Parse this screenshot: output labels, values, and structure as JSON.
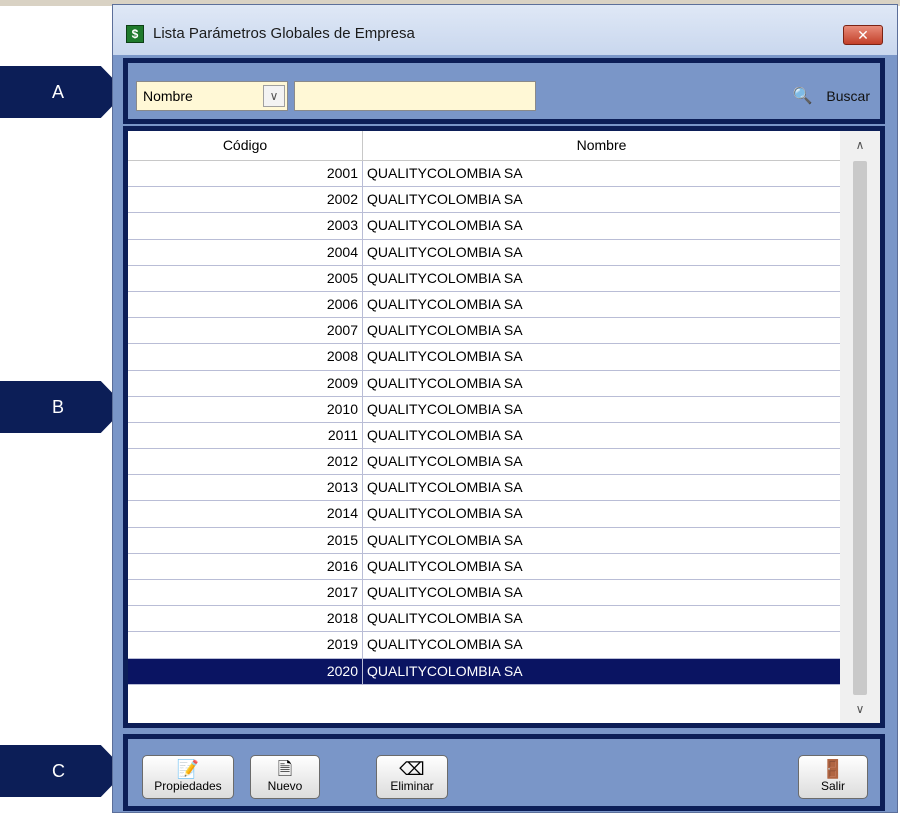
{
  "window": {
    "title": "Lista Parámetros Globales de Empresa",
    "close_label": "✕"
  },
  "callouts": [
    "A",
    "B",
    "C"
  ],
  "filter": {
    "field_value": "Nombre",
    "search_value": "",
    "search_label": "Buscar"
  },
  "grid": {
    "columns": [
      "Código",
      "Nombre"
    ],
    "rows": [
      {
        "codigo": "2001",
        "nombre": "QUALITYCOLOMBIA SA"
      },
      {
        "codigo": "2002",
        "nombre": "QUALITYCOLOMBIA SA"
      },
      {
        "codigo": "2003",
        "nombre": "QUALITYCOLOMBIA SA"
      },
      {
        "codigo": "2004",
        "nombre": "QUALITYCOLOMBIA SA"
      },
      {
        "codigo": "2005",
        "nombre": "QUALITYCOLOMBIA SA"
      },
      {
        "codigo": "2006",
        "nombre": "QUALITYCOLOMBIA SA"
      },
      {
        "codigo": "2007",
        "nombre": "QUALITYCOLOMBIA SA"
      },
      {
        "codigo": "2008",
        "nombre": "QUALITYCOLOMBIA SA"
      },
      {
        "codigo": "2009",
        "nombre": "QUALITYCOLOMBIA SA"
      },
      {
        "codigo": "2010",
        "nombre": "QUALITYCOLOMBIA SA"
      },
      {
        "codigo": "2011",
        "nombre": "QUALITYCOLOMBIA SA"
      },
      {
        "codigo": "2012",
        "nombre": "QUALITYCOLOMBIA SA"
      },
      {
        "codigo": "2013",
        "nombre": "QUALITYCOLOMBIA SA"
      },
      {
        "codigo": "2014",
        "nombre": "QUALITYCOLOMBIA SA"
      },
      {
        "codigo": "2015",
        "nombre": "QUALITYCOLOMBIA SA"
      },
      {
        "codigo": "2016",
        "nombre": "QUALITYCOLOMBIA SA"
      },
      {
        "codigo": "2017",
        "nombre": "QUALITYCOLOMBIA SA"
      },
      {
        "codigo": "2018",
        "nombre": "QUALITYCOLOMBIA SA"
      },
      {
        "codigo": "2019",
        "nombre": "QUALITYCOLOMBIA SA"
      },
      {
        "codigo": "2020",
        "nombre": "QUALITYCOLOMBIA SA"
      }
    ],
    "selected_codigo": "2020"
  },
  "toolbar": {
    "propiedades_label": "Propiedades",
    "nuevo_label": "Nuevo",
    "eliminar_label": "Eliminar",
    "salir_label": "Salir"
  },
  "icons": {
    "app": "spreadsheet-icon",
    "search": "search-icon",
    "propiedades": "properties-icon",
    "nuevo": "new-document-icon",
    "eliminar": "eraser-icon",
    "salir": "exit-door-icon"
  },
  "colors": {
    "frame": "#0c1e57",
    "selection": "#0a1462",
    "field_bg": "#fff8d6",
    "window_bg": "#7a96c8"
  }
}
